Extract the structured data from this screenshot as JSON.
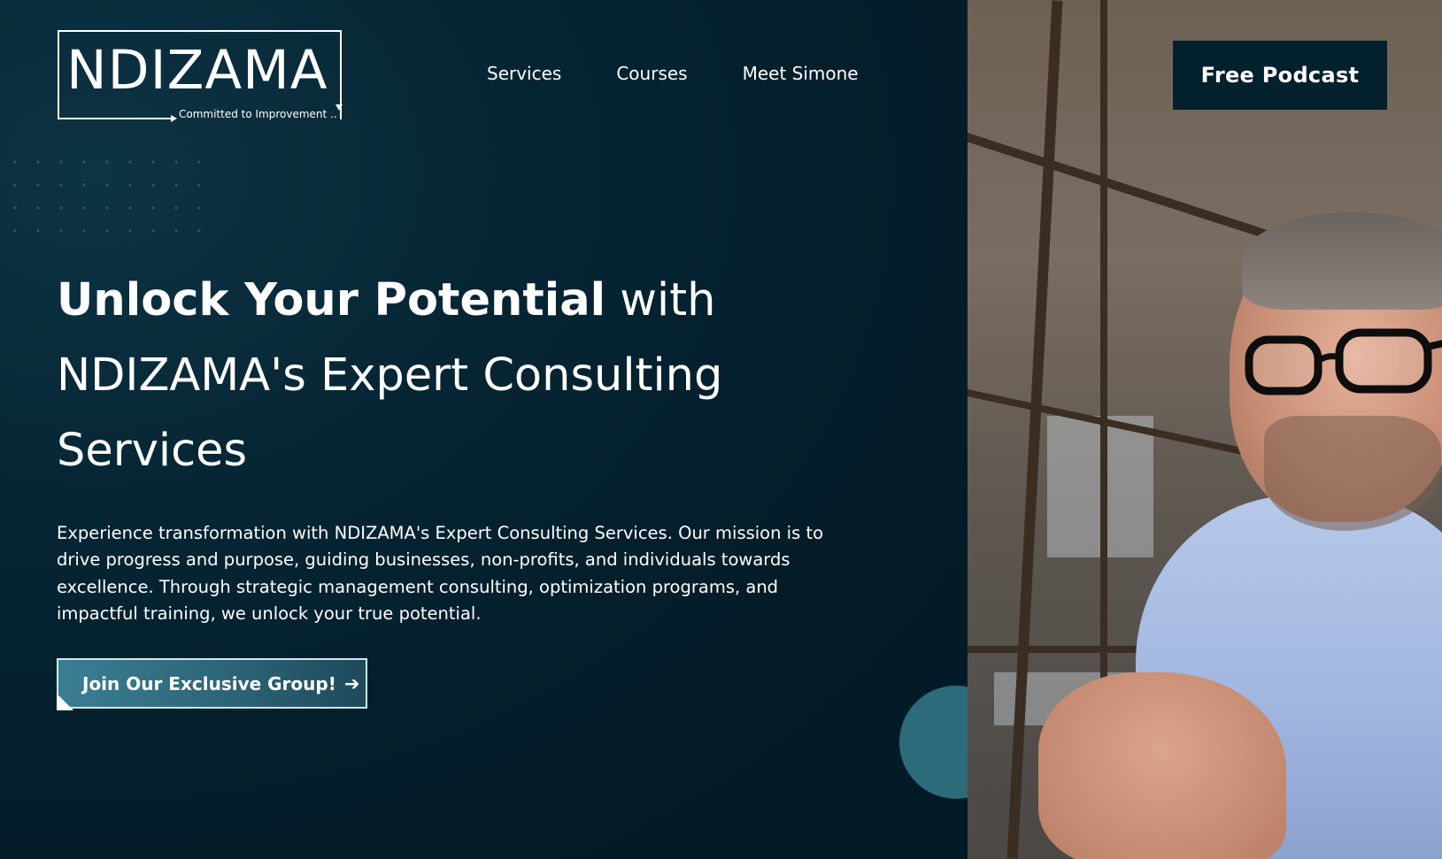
{
  "brand": {
    "name": "NDIZAMA",
    "tagline": "Committed to Improvement .."
  },
  "nav": {
    "items": [
      {
        "label": "Services"
      },
      {
        "label": "Courses"
      },
      {
        "label": "Meet Simone"
      }
    ],
    "cta_label": "Free Podcast"
  },
  "hero": {
    "title_strong": "Unlock Your Potential",
    "title_rest": " with NDIZAMA's Expert Consulting Services",
    "description": "Experience transformation with NDIZAMA's Expert Consulting Services. Our mission is to drive progress and purpose, guiding businesses, non-profits, and individuals towards excellence. Through strategic management consulting, optimization programs, and impactful training, we unlock your true potential.",
    "button_label": "Join Our Exclusive Group!",
    "button_icon": "arrow-right-icon"
  },
  "colors": {
    "background": "#031c28",
    "accent": "#2c6c7a",
    "button_border": "#cfe9f1",
    "text": "#ffffff"
  }
}
